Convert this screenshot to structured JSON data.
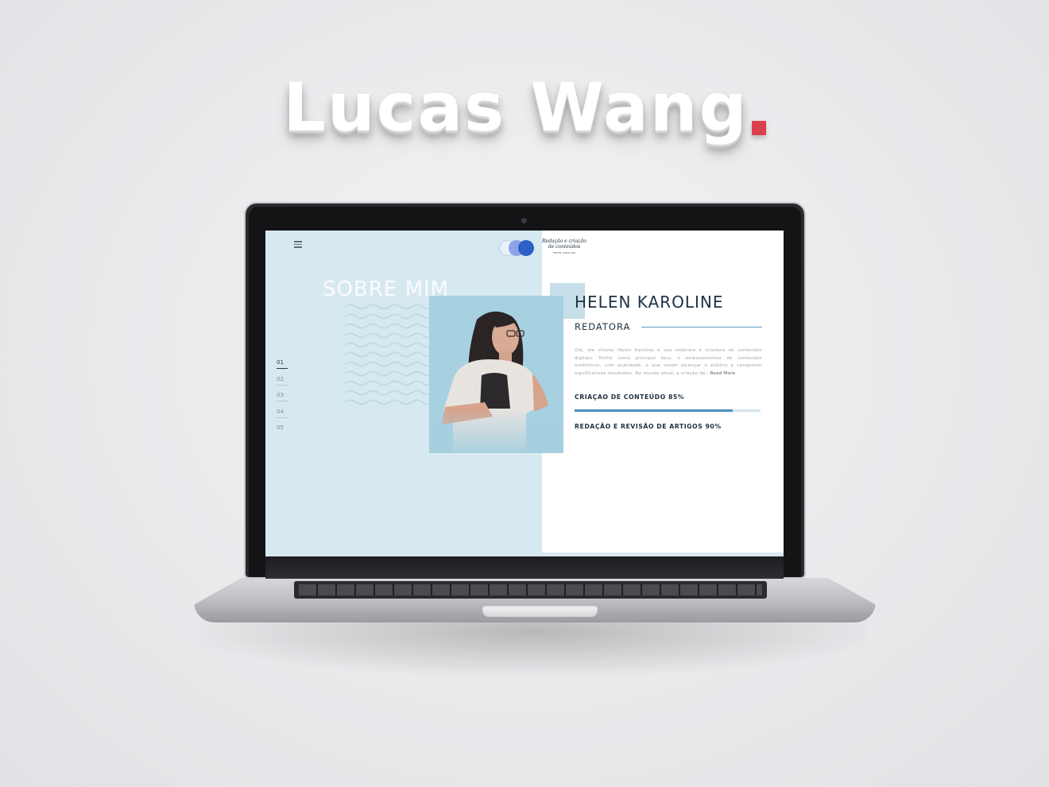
{
  "headline": {
    "text": "Lucas Wang",
    "dot_color": "#d9404a"
  },
  "site": {
    "menu_icon": "hamburger-menu-icon",
    "logo": {
      "title": "Redação e criação de conteúdos",
      "subtitle": "HELEN KAROLINE"
    },
    "section_heading": "SOBRE MIM",
    "slide_nav": [
      "01",
      "02",
      "03",
      "04",
      "05"
    ],
    "active_slide": "01",
    "profile": {
      "name": "HELEN KAROLINE",
      "role": "REDATORA",
      "bio": "Olá, me chamo Helen Karoline e sou redatora e criadora de conteúdos digitais. Tenho como principal foco, o embasamentos de conteúdos autênticos, com qualidade, e que visam alcançar o público e conquistar significativos resultados. No mundo atual, a criação de...",
      "read_more": "Read More"
    },
    "skills": [
      {
        "label": "CRIAÇAO DE CONTEÚDO 85%",
        "percent": 85
      },
      {
        "label": "REDAÇÃO E REVISÃO DE ARTIGOS 90%",
        "percent": 90
      }
    ],
    "colors": {
      "panel": "#d7e9f0",
      "accent": "#4a8fbd",
      "text_dark": "#1f3142"
    }
  }
}
